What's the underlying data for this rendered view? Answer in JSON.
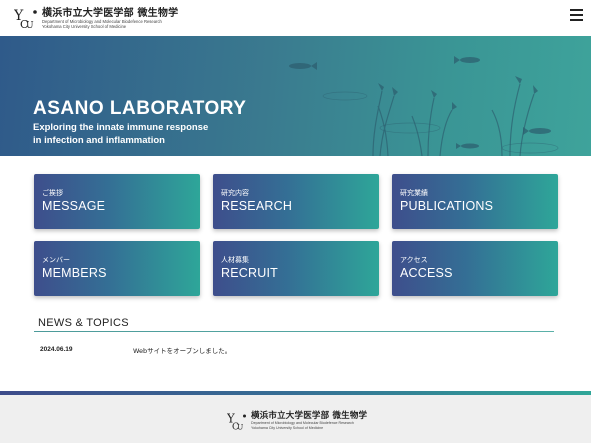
{
  "header": {
    "logo_jp": "横浜市立大学医学部 微生物学",
    "logo_en_line1": "Department of Microbiology and Molecular Biodefence Research",
    "logo_en_line2": "Yokohama City University School of Medicine",
    "menu_icon": "hamburger-menu-icon"
  },
  "hero": {
    "title": "ASANO LABORATORY",
    "subtitle_line1": "Exploring the innate immune response",
    "subtitle_line2": "in infection and inflammation"
  },
  "cards": [
    {
      "jp": "ご挨拶",
      "en": "MESSAGE"
    },
    {
      "jp": "研究内容",
      "en": "RESEARCH"
    },
    {
      "jp": "研究業績",
      "en": "PUBLICATIONS"
    },
    {
      "jp": "メンバー",
      "en": "MEMBERS"
    },
    {
      "jp": "人材募集",
      "en": "RECRUIT"
    },
    {
      "jp": "アクセス",
      "en": "ACCESS"
    }
  ],
  "news": {
    "title": "NEWS & TOPICS",
    "items": [
      {
        "date": "2024.06.19",
        "text": "Webサイトをオープンしました。"
      }
    ]
  },
  "footer": {
    "logo_jp": "横浜市立大学医学部 微生物学",
    "logo_en_line1": "Department of Microbiology and Molecular Biodefence Research",
    "logo_en_line2": "Yokohama City University School of Medicine"
  },
  "colors": {
    "card_start": "#3e4e8c",
    "card_end": "#2ea699",
    "hero_start": "#2f5a8a",
    "hero_end": "#3ea39b",
    "footer_bg": "#efefef"
  }
}
